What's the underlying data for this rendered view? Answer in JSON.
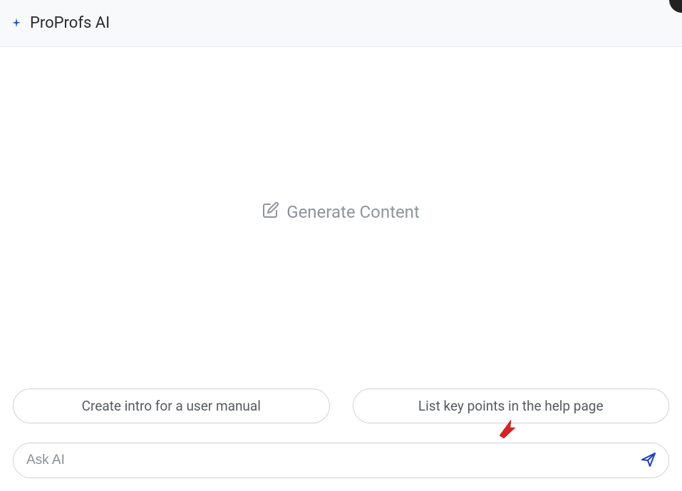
{
  "header": {
    "title": "ProProfs AI"
  },
  "main": {
    "generate_label": "Generate Content"
  },
  "suggestions": [
    {
      "label": "Create intro for a user manual"
    },
    {
      "label": "List key points in the help page"
    }
  ],
  "input": {
    "placeholder": "Ask AI",
    "value": ""
  }
}
